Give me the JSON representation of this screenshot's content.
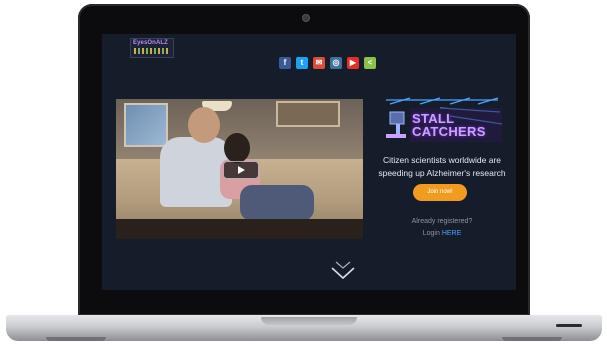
{
  "header": {
    "logo_text": "EyesOnALZ",
    "social": [
      {
        "name": "facebook-icon",
        "glyph": "f",
        "color": "#3b5998"
      },
      {
        "name": "twitter-icon",
        "glyph": "t",
        "color": "#1da1f2"
      },
      {
        "name": "email-icon",
        "glyph": "✉",
        "color": "#dd4b39"
      },
      {
        "name": "instagram-icon",
        "glyph": "◎",
        "color": "#3f729b"
      },
      {
        "name": "youtube-icon",
        "glyph": "▶",
        "color": "#e52d27"
      },
      {
        "name": "share-icon",
        "glyph": "<",
        "color": "#8bc34a"
      }
    ]
  },
  "hero": {
    "video_play_icon": "play-icon",
    "game_logo_line1": "STALL",
    "game_logo_line2": "CATCHERS",
    "tagline": "Citizen scientists worldwide are speeding up Alzheimer's research",
    "join_label": "Join now!",
    "already_registered": "Already registered?",
    "login_prefix": "Login ",
    "login_link": "HERE"
  },
  "colors": {
    "screen_bg": "#151c2a",
    "accent_orange": "#f29c1f",
    "link_blue": "#4fa3ff",
    "logo_purple": "#c9a3ff"
  }
}
